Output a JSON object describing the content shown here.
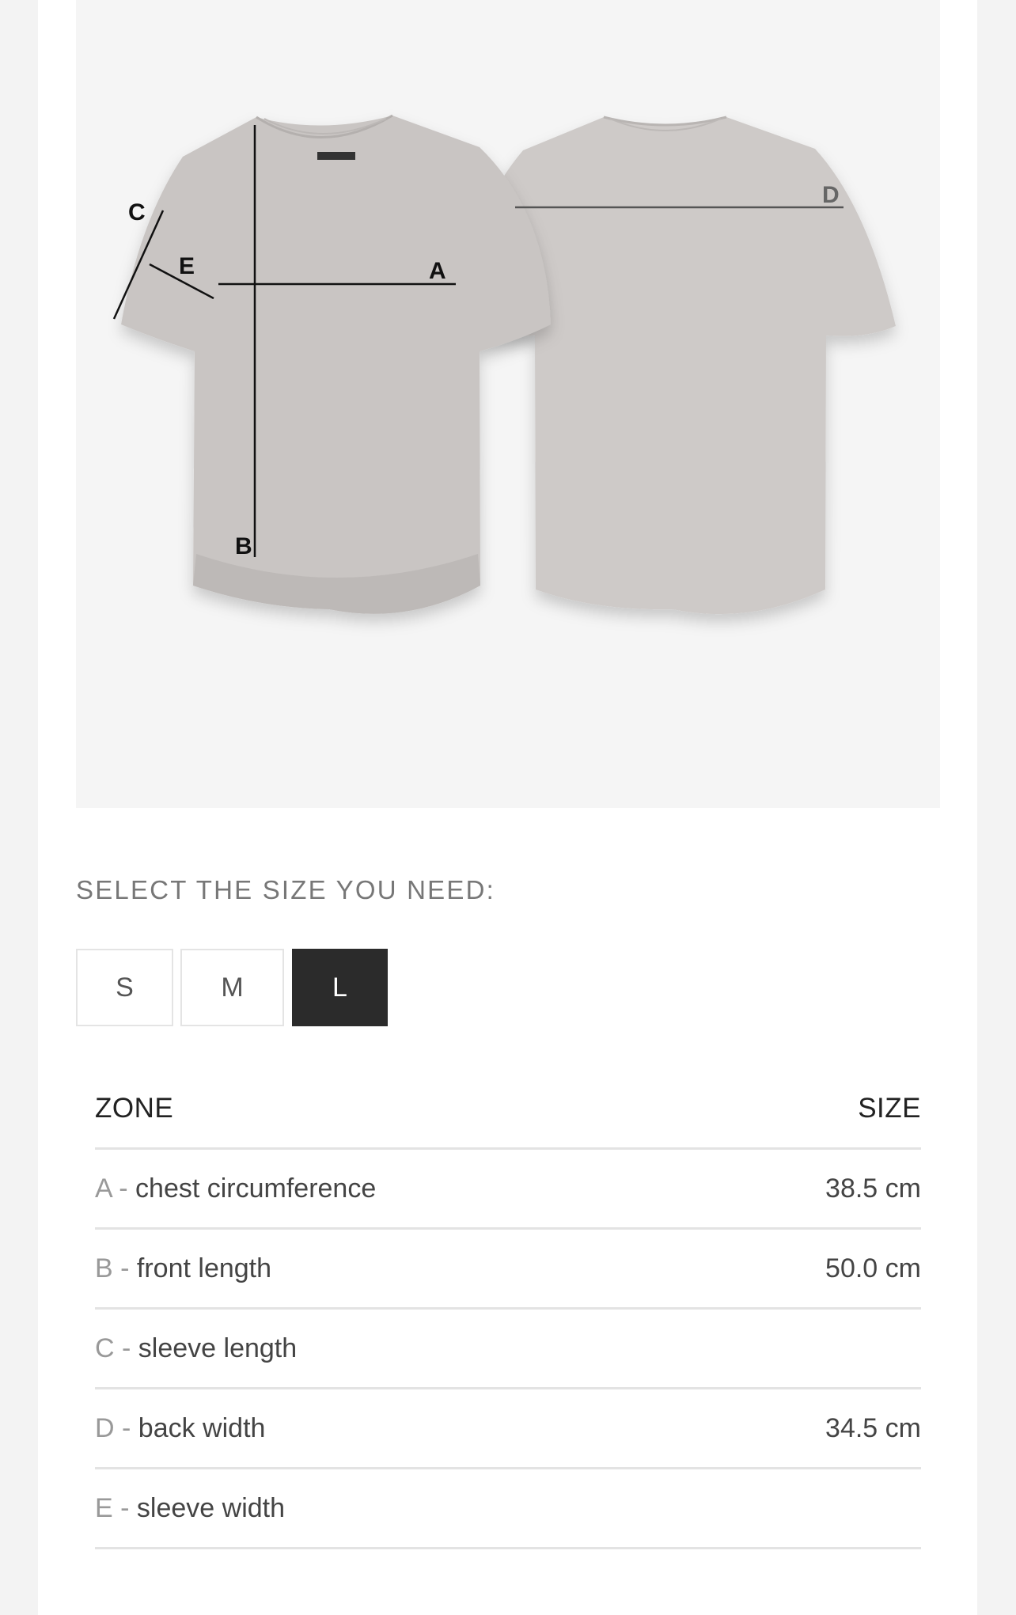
{
  "diagram": {
    "labels": [
      "A",
      "B",
      "C",
      "D",
      "E"
    ],
    "shirt_color": "#c9c5c3"
  },
  "size_selector": {
    "title": "SELECT THE SIZE YOU NEED:",
    "options": [
      "S",
      "M",
      "L"
    ],
    "selected": "L"
  },
  "table": {
    "header_zone": "ZONE",
    "header_size": "SIZE",
    "rows": [
      {
        "letter": "A",
        "name": "chest circumference",
        "value": "38.5 cm"
      },
      {
        "letter": "B",
        "name": "front length",
        "value": "50.0 cm"
      },
      {
        "letter": "C",
        "name": "sleeve length",
        "value": ""
      },
      {
        "letter": "D",
        "name": "back width",
        "value": "34.5 cm"
      },
      {
        "letter": "E",
        "name": "sleeve width",
        "value": ""
      }
    ]
  }
}
